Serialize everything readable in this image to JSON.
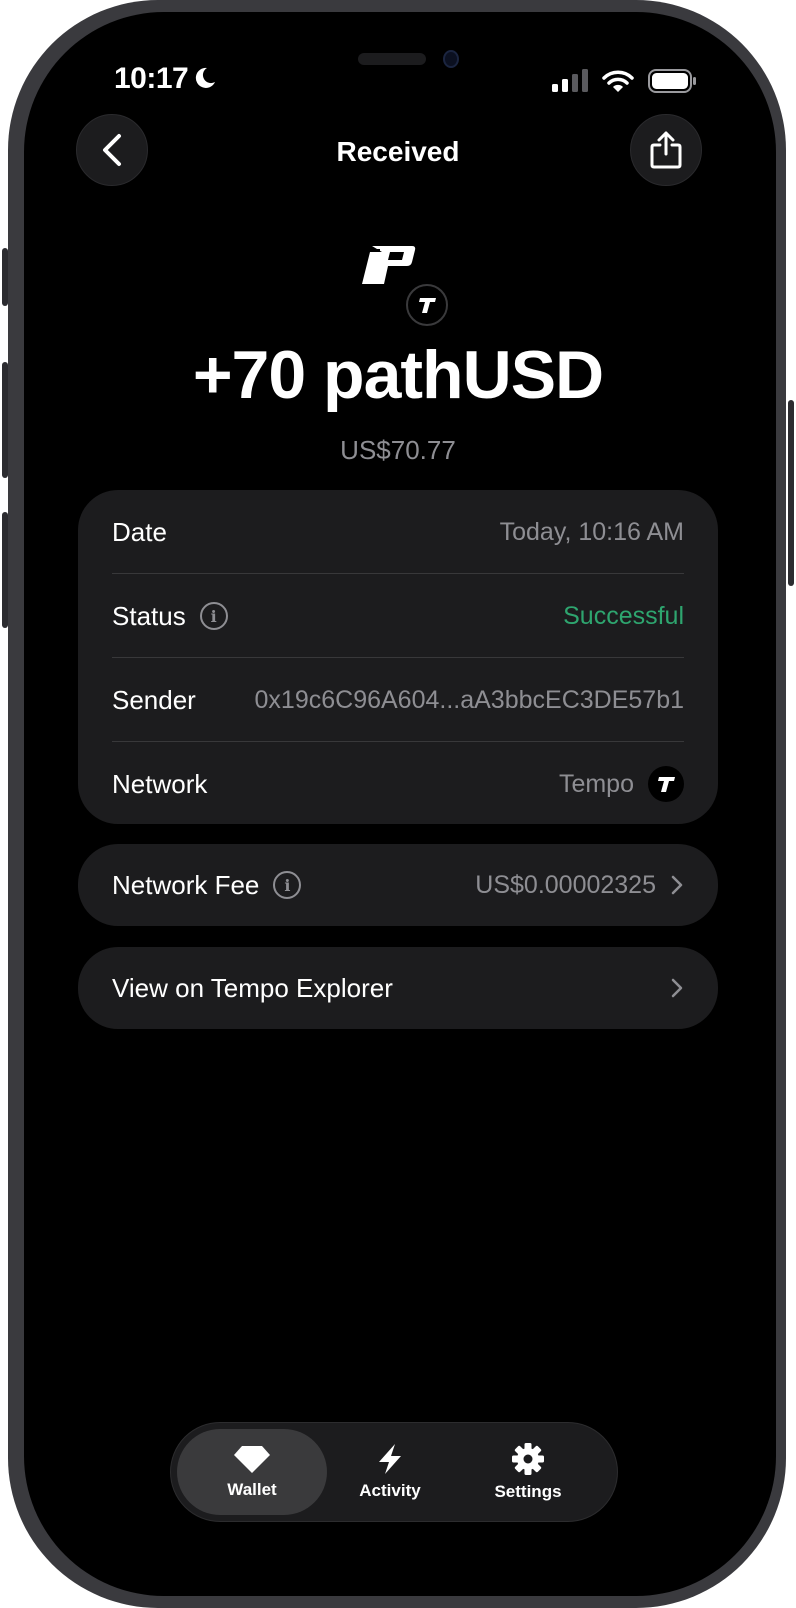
{
  "status_bar": {
    "time": "10:17"
  },
  "header": {
    "title": "Received",
    "back_icon": "chevron-left-icon",
    "share_icon": "share-icon"
  },
  "asset": {
    "amount": "+70 pathUSD",
    "fiat": "US$70.77",
    "token_icon": "pathusd-logo",
    "network_icon": "tempo-logo"
  },
  "details": {
    "date": {
      "label": "Date",
      "value": "Today, 10:16 AM"
    },
    "status": {
      "label": "Status",
      "value": "Successful",
      "color": "#2ea56f"
    },
    "sender": {
      "label": "Sender",
      "value": "0x19c6C96A604...aA3bbcEC3DE57b1"
    },
    "network": {
      "label": "Network",
      "value": "Tempo"
    }
  },
  "fee": {
    "label": "Network Fee",
    "value": "US$0.00002325"
  },
  "explorer": {
    "label": "View on Tempo Explorer"
  },
  "tabbar": {
    "items": [
      {
        "label": "Wallet",
        "icon": "diamond-icon",
        "active": true
      },
      {
        "label": "Activity",
        "icon": "bolt-icon",
        "active": false
      },
      {
        "label": "Settings",
        "icon": "gear-icon",
        "active": false
      }
    ]
  }
}
